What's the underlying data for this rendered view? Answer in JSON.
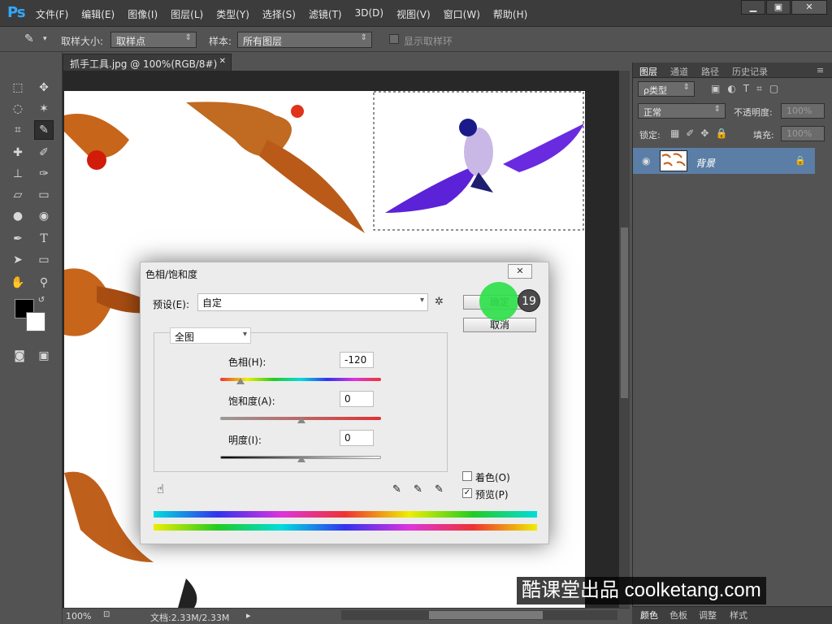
{
  "menubar": {
    "logo": "Ps",
    "items": [
      "文件(F)",
      "编辑(E)",
      "图像(I)",
      "图层(L)",
      "类型(Y)",
      "选择(S)",
      "滤镜(T)",
      "3D(D)",
      "视图(V)",
      "窗口(W)",
      "帮助(H)"
    ]
  },
  "options": {
    "sample_size_label": "取样大小:",
    "sample_size_value": "取样点",
    "sample_label": "样本:",
    "sample_value": "所有图层",
    "show_ring_label": "显示取样环"
  },
  "document": {
    "tab_title": "抓手工具.jpg @ 100%(RGB/8#) *"
  },
  "status": {
    "zoom": "100%",
    "doc_size": "文档:2.33M/2.33M"
  },
  "panel": {
    "tabs": [
      "图层",
      "通道",
      "路径",
      "历史记录"
    ],
    "filter_label": "ρ类型",
    "blend_mode": "正常",
    "opacity_label": "不透明度:",
    "opacity_value": "100%",
    "lock_label": "锁定:",
    "fill_label": "填充:",
    "fill_value": "100%",
    "layer_name": "背景"
  },
  "bottom_tabs": [
    "颜色",
    "色板",
    "调整",
    "样式"
  ],
  "dialog": {
    "title": "色相/饱和度",
    "preset_label": "预设(E):",
    "preset_value": "自定",
    "ok_label": "确定",
    "cancel_label": "取消",
    "range_value": "全图",
    "hue_label": "色相(H):",
    "hue_value": "-120",
    "saturation_label": "饱和度(A):",
    "saturation_value": "0",
    "lightness_label": "明度(I):",
    "lightness_value": "0",
    "colorize_label": "着色(O)",
    "preview_label": "预览(P)"
  },
  "step_marker": "19",
  "watermark": "酷课堂出品 coolketang.com",
  "colors": {
    "accent_green": "#2fe04a",
    "selected_layer": "#5b7ea6",
    "ps_blue": "#31a8ff"
  }
}
